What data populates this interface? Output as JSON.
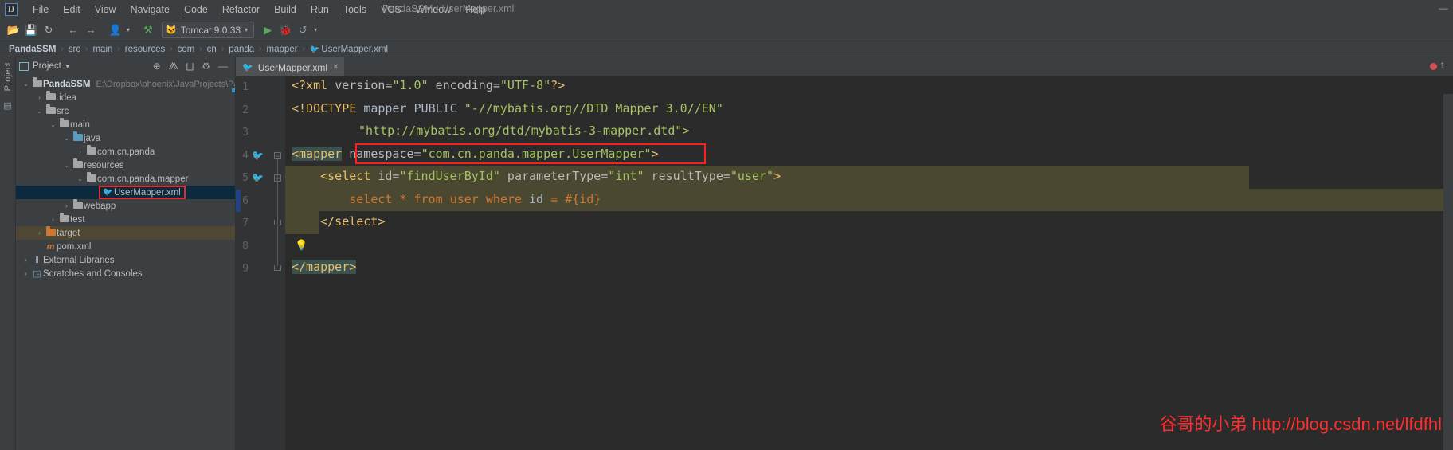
{
  "window": {
    "title": "PandaSSM - UserMapper.xml",
    "logo_text": "IJ",
    "minimize": "—",
    "maximize": "□",
    "close": "✕"
  },
  "menubar": {
    "items": [
      {
        "pre": "",
        "mn": "F",
        "post": "ile"
      },
      {
        "pre": "",
        "mn": "E",
        "post": "dit"
      },
      {
        "pre": "",
        "mn": "V",
        "post": "iew"
      },
      {
        "pre": "",
        "mn": "N",
        "post": "avigate"
      },
      {
        "pre": "",
        "mn": "C",
        "post": "ode"
      },
      {
        "pre": "",
        "mn": "R",
        "post": "efactor"
      },
      {
        "pre": "",
        "mn": "B",
        "post": "uild"
      },
      {
        "pre": "R",
        "mn": "u",
        "post": "n"
      },
      {
        "pre": "",
        "mn": "T",
        "post": "ools"
      },
      {
        "pre": "V",
        "mn": "C",
        "post": "S"
      },
      {
        "pre": "",
        "mn": "W",
        "post": "indow"
      },
      {
        "pre": "",
        "mn": "H",
        "post": "elp"
      }
    ]
  },
  "toolbar": {
    "open_icon": "📂",
    "save_icon": "💾",
    "sync_icon": "↻",
    "back_icon": "←",
    "forward_icon": "→",
    "profile_icon": "👤",
    "profile_caret": "▾",
    "build_icon": "⚒",
    "run_config": {
      "app_icon": "🐱",
      "label": "Tomcat 9.0.33",
      "caret": "▾"
    },
    "run_icon": "▶",
    "debug_icon": "🐞",
    "rerun_icon": "↺"
  },
  "breadcrumb": {
    "separator": "›",
    "items": [
      {
        "label": "PandaSSM",
        "icon": ""
      },
      {
        "label": "src",
        "icon": ""
      },
      {
        "label": "main",
        "icon": ""
      },
      {
        "label": "resources",
        "icon": ""
      },
      {
        "label": "com",
        "icon": ""
      },
      {
        "label": "cn",
        "icon": ""
      },
      {
        "label": "panda",
        "icon": ""
      },
      {
        "label": "mapper",
        "icon": ""
      },
      {
        "label": "UserMapper.xml",
        "icon": "🐦"
      }
    ]
  },
  "rail": {
    "project_label": "Project",
    "structure_icon": "▤"
  },
  "project_panel": {
    "title": "Project",
    "caret": "▾",
    "icons": {
      "locate": "⊕",
      "expand": "⨇",
      "collapse": "⨆",
      "settings": "⚙",
      "hide": "—"
    },
    "tree": [
      {
        "label": "PandaSSM",
        "path": "E:\\Dropbox\\phoenix\\JavaProjects\\Pa",
        "depth": 0,
        "arrow": "⌄",
        "kind": "module",
        "bold": true
      },
      {
        "label": ".idea",
        "path": "",
        "depth": 1,
        "arrow": "›",
        "kind": "folder-grey",
        "bold": false
      },
      {
        "label": "src",
        "path": "",
        "depth": 1,
        "arrow": "⌄",
        "kind": "folder-grey",
        "bold": false
      },
      {
        "label": "main",
        "path": "",
        "depth": 2,
        "arrow": "⌄",
        "kind": "folder-grey",
        "bold": false
      },
      {
        "label": "java",
        "path": "",
        "depth": 3,
        "arrow": "⌄",
        "kind": "folder-blue",
        "bold": false
      },
      {
        "label": "com.cn.panda",
        "path": "",
        "depth": 4,
        "arrow": "›",
        "kind": "package",
        "bold": false
      },
      {
        "label": "resources",
        "path": "",
        "depth": 3,
        "arrow": "⌄",
        "kind": "folder-resources",
        "bold": false
      },
      {
        "label": "com.cn.panda.mapper",
        "path": "",
        "depth": 4,
        "arrow": "⌄",
        "kind": "folder-grey",
        "bold": false
      },
      {
        "label": "UserMapper.xml",
        "path": "",
        "depth": 5,
        "arrow": "",
        "kind": "mybatis-file",
        "bold": false,
        "selected": true,
        "annotated": true
      },
      {
        "label": "webapp",
        "path": "",
        "depth": 3,
        "arrow": "›",
        "kind": "folder-web",
        "bold": false
      },
      {
        "label": "test",
        "path": "",
        "depth": 2,
        "arrow": "›",
        "kind": "folder-grey",
        "bold": false
      },
      {
        "label": "target",
        "path": "",
        "depth": 1,
        "arrow": "›",
        "kind": "folder-orange",
        "bold": false,
        "excluded": true
      },
      {
        "label": "pom.xml",
        "path": "",
        "depth": 1,
        "arrow": "",
        "kind": "maven-file",
        "bold": false
      },
      {
        "label": "External Libraries",
        "path": "",
        "depth": 0,
        "arrow": "›",
        "kind": "library",
        "bold": false
      },
      {
        "label": "Scratches and Consoles",
        "path": "",
        "depth": 0,
        "arrow": "›",
        "kind": "scratch",
        "bold": false
      }
    ]
  },
  "editor": {
    "tab": {
      "icon": "🐦",
      "label": "UserMapper.xml",
      "close": "✕"
    },
    "error_count": "1",
    "bulb_icon": "💡",
    "gutter_icon": "🐦",
    "fold_minus": "−",
    "lines": [
      {
        "num": "1"
      },
      {
        "num": "2"
      },
      {
        "num": "3"
      },
      {
        "num": "4"
      },
      {
        "num": "5"
      },
      {
        "num": "6"
      },
      {
        "num": "7"
      },
      {
        "num": "8"
      },
      {
        "num": "9"
      }
    ],
    "code": {
      "l1_a": "<?xml ",
      "l1_b": "version=",
      "l1_c": "\"1.0\"",
      "l1_d": " encoding=",
      "l1_e": "\"UTF-8\"",
      "l1_f": "?>",
      "l2_a": "<!DOCTYPE ",
      "l2_b": "mapper PUBLIC ",
      "l2_c": "\"-//mybatis.org//DTD Mapper 3.0//EN\"",
      "l3_a": "\"http://mybatis.org/dtd/mybatis-3-mapper.dtd\">",
      "l4_tag": "<mapper",
      "l4_attr": " namespace=",
      "l4_val": "\"com.cn.panda.mapper.UserMapper\"",
      "l4_close": ">",
      "l5_tag": "    <select ",
      "l5_a1": "id=",
      "l5_v1": "\"findUserById\"",
      "l5_a2": " parameterType=",
      "l5_v2": "\"int\"",
      "l5_a3": " resultType=",
      "l5_v3": "\"user\"",
      "l5_close": ">",
      "l6_a": "        select * from user where ",
      "l6_b": "id",
      "l6_c": " = #{id}",
      "l7": "    </select>",
      "l9": "</mapper>"
    }
  },
  "watermark": {
    "text": "谷哥的小弟 http://blog.csdn.net/lfdfhl"
  }
}
